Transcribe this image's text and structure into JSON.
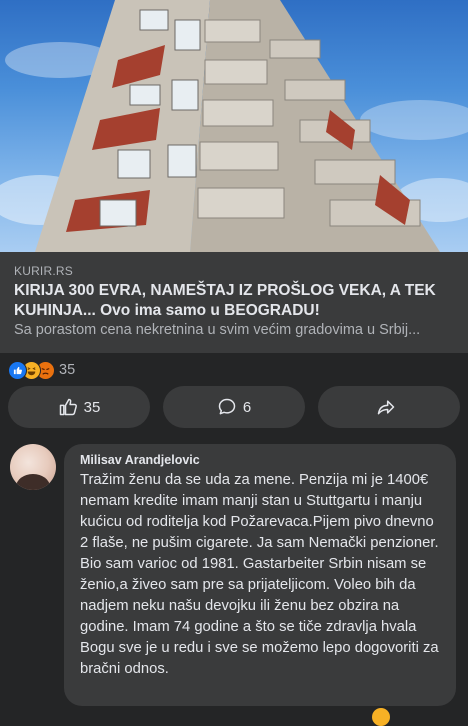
{
  "post": {
    "link": {
      "source": "KURIR.RS",
      "headline": "KIRIJA 300 EVRA, NAMEŠTAJ IZ PROŠLOG VEKA, A TEK KUHINJA... Ovo ima samo u BEOGRADU!",
      "subtitle": "Sa porastom cena nekretnina u svim većim gradovima u Srbij..."
    },
    "reactions": {
      "count": "35",
      "types": [
        "like-icon",
        "haha-icon",
        "angry-icon"
      ]
    },
    "actions": {
      "like_count": "35",
      "comment_count": "6"
    }
  },
  "comment": {
    "author": "Milisav Arandjelovic",
    "text": "Tražim ženu da se uda za mene. Penzija mi je 1400€ nemam kredite imam manji stan u Stuttgartu i manju kućicu od roditelja kod Požarevaca.Pijem pivo dnevno 2 flaše, ne pušim cigarete. Ja sam Nemački penzioner. Bio sam varioc od 1981. Gastarbeiter Srbin nisam se ženio,a živeo sam pre sa prijateljicom. Voleo bih da nadjem neku našu devojku ili ženu bez obzira na godine. Imam 74 godine a što se tiče zdravlja hvala Bogu sve je u redu i sve se možemo lepo dogovoriti za bračni odnos."
  },
  "colors": {
    "background": "#242526",
    "surface": "#3a3b3c",
    "text_primary": "#e4e6eb",
    "text_secondary": "#b0b3b8",
    "like_blue": "#1877f2"
  }
}
